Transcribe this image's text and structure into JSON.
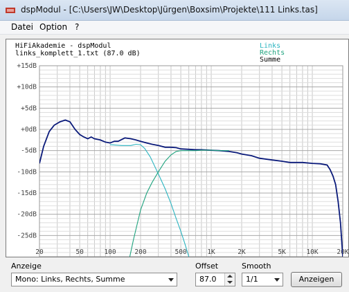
{
  "window": {
    "title": "dspModul - [C:\\Users\\JW\\Desktop\\Jürgen\\Boxsim\\Projekte\\111 Links.tas]"
  },
  "menu": {
    "items": [
      "Datei",
      "Option",
      "?"
    ]
  },
  "plot": {
    "header_line1": "HiFiAkademie - dspModul",
    "header_line2": "links_komplett_1.txt  (87.0 dB)",
    "legend": [
      {
        "label": "Links",
        "color": "#2ab4c0"
      },
      {
        "label": "Rechts",
        "color": "#1fa37e"
      },
      {
        "label": "Summe",
        "color": "#000000"
      }
    ],
    "colors": {
      "links": "#2ab4c0",
      "rechts": "#1fa37e",
      "summe": "#0a1a7a",
      "grid": "#c8c8c8"
    }
  },
  "chart_data": {
    "type": "line",
    "xscale": "log",
    "xlim": [
      20,
      20000
    ],
    "ylim": [
      -30,
      15
    ],
    "x_tick_labels": [
      "20",
      "50",
      "100",
      "200",
      "500",
      "1K",
      "2K",
      "5K",
      "10K",
      "20K"
    ],
    "x_tick_values": [
      20,
      50,
      100,
      200,
      500,
      1000,
      2000,
      5000,
      10000,
      20000
    ],
    "y_tick_labels": [
      "+15dB",
      "+10dB",
      "+5dB",
      "+0dB",
      "-5dB",
      "-10dB",
      "-15dB",
      "-20dB",
      "-25dB"
    ],
    "y_tick_values": [
      15,
      10,
      5,
      0,
      -5,
      -10,
      -15,
      -20,
      -25
    ],
    "series": [
      {
        "name": "Summe",
        "x": [
          20,
          22,
          25,
          28,
          32,
          36,
          40,
          45,
          50,
          55,
          60,
          65,
          70,
          80,
          90,
          100,
          110,
          120,
          140,
          160,
          180,
          200,
          230,
          260,
          300,
          350,
          400,
          450,
          500,
          600,
          700,
          800,
          1000,
          1200,
          1500,
          1800,
          2000,
          2500,
          3000,
          4000,
          5000,
          6000,
          8000,
          10000,
          12000,
          14000,
          15000,
          16000,
          17000,
          18000,
          19000,
          20000
        ],
        "y": [
          -8,
          -4,
          -0.5,
          1,
          1.8,
          2.2,
          1.8,
          0,
          -1.2,
          -1.8,
          -2.2,
          -1.8,
          -2.2,
          -2.5,
          -3,
          -3.2,
          -2.8,
          -2.8,
          -2,
          -2.2,
          -2.5,
          -2.8,
          -3.2,
          -3.5,
          -3.8,
          -4.2,
          -4.2,
          -4.3,
          -4.6,
          -4.7,
          -4.8,
          -4.8,
          -4.9,
          -5.0,
          -5.2,
          -5.5,
          -5.8,
          -6.2,
          -6.8,
          -7.2,
          -7.5,
          -7.8,
          -7.8,
          -8,
          -8.1,
          -8.4,
          -9.5,
          -11,
          -13,
          -17,
          -22,
          -30
        ]
      },
      {
        "name": "Links",
        "x": [
          100,
          130,
          160,
          180,
          200,
          220,
          250,
          280,
          300,
          350,
          400,
          450,
          500,
          550,
          600,
          650
        ],
        "y": [
          -3.6,
          -3.8,
          -3.8,
          -3.5,
          -3.6,
          -4.5,
          -6.5,
          -9,
          -10.5,
          -14,
          -17.5,
          -21,
          -24,
          -27,
          -30,
          -32
        ]
      },
      {
        "name": "Rechts",
        "x": [
          150,
          170,
          200,
          230,
          260,
          300,
          350,
          400,
          450,
          500,
          600,
          700,
          800,
          1000,
          1200,
          1500
        ],
        "y": [
          -32,
          -26,
          -19,
          -15,
          -12.5,
          -10,
          -7.5,
          -6,
          -5.2,
          -5,
          -5,
          -5,
          -4.9,
          -4.9,
          -5,
          -5
        ]
      }
    ]
  },
  "controls": {
    "anzeige_label": "Anzeige",
    "anzeige_value": "Mono: Links, Rechts, Summe",
    "offset_label": "Offset",
    "offset_value": "87.0",
    "smooth_label": "Smooth",
    "smooth_value": "1/1",
    "anzeigen_button": "Anzeigen"
  }
}
